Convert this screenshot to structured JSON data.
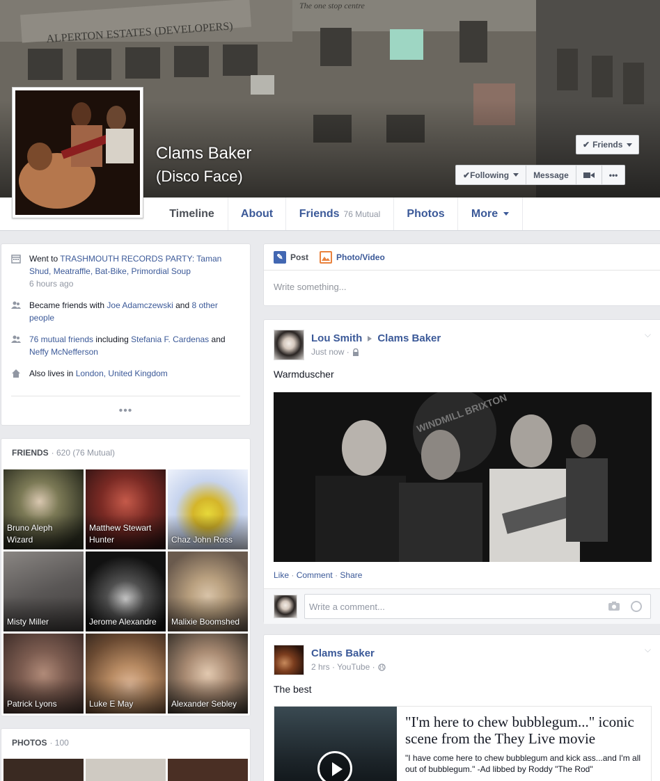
{
  "profile": {
    "name": "Clams Baker",
    "alternate_name": "(Disco Face)",
    "cover_signs": [
      "ALPERTON ESTATES (DEVELOPERS)",
      "The one stop centre"
    ],
    "buttons": {
      "friends": "Friends",
      "following": "Following",
      "message": "Message",
      "more": "•••"
    }
  },
  "tabs": [
    {
      "label": "Timeline",
      "active": true
    },
    {
      "label": "About"
    },
    {
      "label": "Friends",
      "sub": "76 Mutual"
    },
    {
      "label": "Photos"
    },
    {
      "label": "More"
    }
  ],
  "intro": {
    "event": {
      "prefix": "Went to ",
      "link": "TRASHMOUTH RECORDS PARTY: Taman Shud, Meatraffle, Bat-Bike, Primordial Soup",
      "time": "6 hours ago"
    },
    "friends": {
      "prefix": "Became friends with ",
      "name": "Joe Adamczewski",
      "mid": " and ",
      "others": "8 other people"
    },
    "mutual": {
      "link": "76 mutual friends",
      "mid1": " including ",
      "name1": "Stefania F. Cardenas",
      "mid2": " and ",
      "name2": "Neffy McNefferson"
    },
    "lives": {
      "prefix": "Also lives in ",
      "link": "London, United Kingdom"
    },
    "more": "•••"
  },
  "friends_section": {
    "title": "FRIENDS",
    "count": "· 620 (76 Mutual)",
    "friends": [
      {
        "name": "Bruno Aleph Wizard",
        "color": "#3a3f2a"
      },
      {
        "name": "Matthew Stewart Hunter",
        "color": "#6b2a24"
      },
      {
        "name": "Chaz John Ross",
        "color": "#b9c8e2"
      },
      {
        "name": "Misty Miller",
        "color": "#6d6a68"
      },
      {
        "name": "Jerome Alexandre",
        "color": "#151515"
      },
      {
        "name": "Malixie Boomshed",
        "color": "#8a7a6a"
      },
      {
        "name": "Patrick Lyons",
        "color": "#6f5a52"
      },
      {
        "name": "Luke E May",
        "color": "#8a6a4a"
      },
      {
        "name": "Alexander Sebley",
        "color": "#a68c78"
      }
    ]
  },
  "photos_section": {
    "title": "PHOTOS",
    "count": "· 100"
  },
  "composer": {
    "post": "Post",
    "photo": "Photo/Video",
    "placeholder": "Write something..."
  },
  "post1": {
    "author": "Lou Smith",
    "target": "Clams Baker",
    "time": "Just now ·",
    "text": "Warmduscher",
    "photo_sign": "WINDMILL BRIXTON",
    "like": "Like",
    "comment": "Comment",
    "share": "Share",
    "comment_placeholder": "Write a comment..."
  },
  "post2": {
    "author": "Clams Baker",
    "time": "2 hrs · YouTube ·",
    "text": "The best",
    "video_title": "\"I'm here to chew bubblegum...\" iconic scene from the They Live movie",
    "video_desc": "\"I have come here to chew bubblegum and kick ass...and I'm all out of bubblegum.\" -Ad libbed by Roddy \"The Rod\""
  }
}
